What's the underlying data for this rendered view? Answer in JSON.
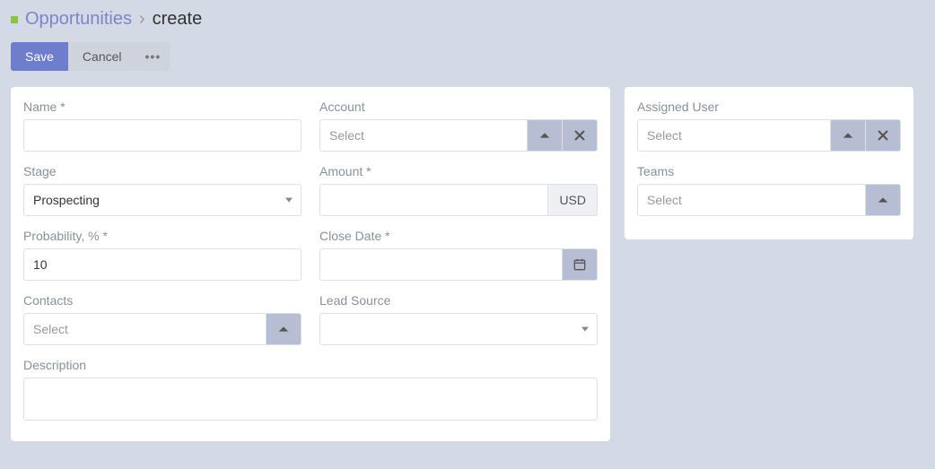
{
  "breadcrumb": {
    "entity": "Opportunities",
    "sep": "›",
    "current": "create"
  },
  "toolbar": {
    "save_label": "Save",
    "cancel_label": "Cancel",
    "more_label": "•••"
  },
  "main": {
    "name": {
      "label": "Name *",
      "value": ""
    },
    "account": {
      "label": "Account",
      "placeholder": "Select"
    },
    "stage": {
      "label": "Stage",
      "value": "Prospecting"
    },
    "amount": {
      "label": "Amount *",
      "value": "",
      "currency": "USD"
    },
    "probability": {
      "label": "Probability, % *",
      "value": "10"
    },
    "close_date": {
      "label": "Close Date *",
      "value": ""
    },
    "contacts": {
      "label": "Contacts",
      "placeholder": "Select"
    },
    "lead_source": {
      "label": "Lead Source",
      "value": ""
    },
    "description": {
      "label": "Description",
      "value": ""
    }
  },
  "side": {
    "assigned_user": {
      "label": "Assigned User",
      "placeholder": "Select"
    },
    "teams": {
      "label": "Teams",
      "placeholder": "Select"
    }
  }
}
